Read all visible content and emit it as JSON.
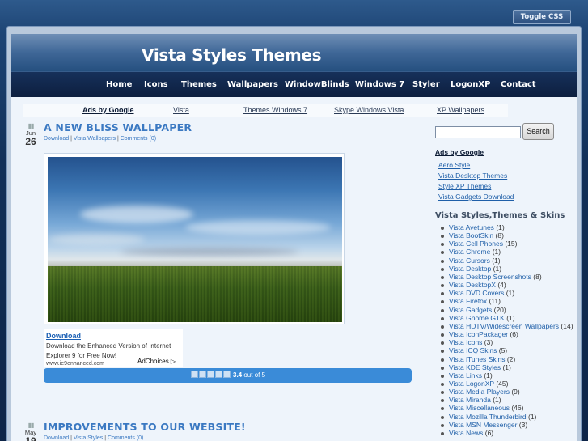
{
  "toggle_css": "Toggle CSS",
  "site": {
    "title": "Vista Styles Themes"
  },
  "nav": [
    "Home",
    "Icons",
    "Themes",
    "Wallpapers",
    "WindowBlinds",
    "Windows 7",
    "Styler",
    "LogonXP",
    "Contact"
  ],
  "adbar": {
    "ads_by": "Ads by Google",
    "links": [
      "Vista",
      "Themes Windows 7",
      "Skype Windows Vista",
      "XP Wallpapers"
    ]
  },
  "posts": [
    {
      "month": "Jun",
      "day": "26",
      "title": "A NEW BLISS WALLPAPER",
      "meta": {
        "cat1": "Download",
        "cat2": "Vista Wallpapers",
        "comments": "Comments (0)"
      }
    },
    {
      "month": "May",
      "day": "19",
      "title": "IMPROVEMENTS TO OUR WEBSITE!",
      "meta": {
        "cat1": "Download",
        "cat2": "Vista Styles",
        "comments": "Comments (0)"
      }
    }
  ],
  "ad": {
    "link": "Download",
    "text": "Download the Enhanced Version of Internet Explorer 9 for Free Now!",
    "url": "www.ie9enhanced.com",
    "choices": "AdChoices ▷"
  },
  "rating": {
    "value": "3.4",
    "suffix": "out of 5",
    "score_fraction": 0.68
  },
  "sidebar": {
    "search_button": "Search",
    "ads_title": "Ads by Google",
    "ad_links": [
      "Aero Style",
      "Vista Desktop Themes",
      "Style XP Themes",
      "Vista Gadgets Download"
    ],
    "categories_heading": "Vista Styles,Themes & Skins",
    "categories": [
      {
        "name": "Vista Avetunes",
        "count": "(1)"
      },
      {
        "name": "Vista BootSkin",
        "count": "(8)"
      },
      {
        "name": "Vista Cell Phones",
        "count": "(15)"
      },
      {
        "name": "Vista Chrome",
        "count": "(1)"
      },
      {
        "name": "Vista Cursors",
        "count": "(1)"
      },
      {
        "name": "Vista Desktop",
        "count": "(1)"
      },
      {
        "name": "Vista Desktop Screenshots",
        "count": "(8)"
      },
      {
        "name": "Vista DesktopX",
        "count": "(4)"
      },
      {
        "name": "Vista DVD Covers",
        "count": "(1)"
      },
      {
        "name": "Vista Firefox",
        "count": "(11)"
      },
      {
        "name": "Vista Gadgets",
        "count": "(20)"
      },
      {
        "name": "Vista Gnome GTK",
        "count": "(1)"
      },
      {
        "name": "Vista HDTV/Widescreen Wallpapers",
        "count": "(14)"
      },
      {
        "name": "Vista IconPackager",
        "count": "(6)"
      },
      {
        "name": "Vista Icons",
        "count": "(3)"
      },
      {
        "name": "Vista ICQ Skins",
        "count": "(5)"
      },
      {
        "name": "Vista iTunes Skins",
        "count": "(2)"
      },
      {
        "name": "Vista KDE Styles",
        "count": "(1)"
      },
      {
        "name": "Vista Links",
        "count": "(1)"
      },
      {
        "name": "Vista LogonXP",
        "count": "(45)"
      },
      {
        "name": "Vista Media Players",
        "count": "(9)"
      },
      {
        "name": "Vista Miranda",
        "count": "(1)"
      },
      {
        "name": "Vista Miscellaneous",
        "count": "(46)"
      },
      {
        "name": "Vista Mozilla Thunderbird",
        "count": "(1)"
      },
      {
        "name": "Vista MSN Messenger",
        "count": "(3)"
      },
      {
        "name": "Vista News",
        "count": "(6)"
      }
    ]
  }
}
